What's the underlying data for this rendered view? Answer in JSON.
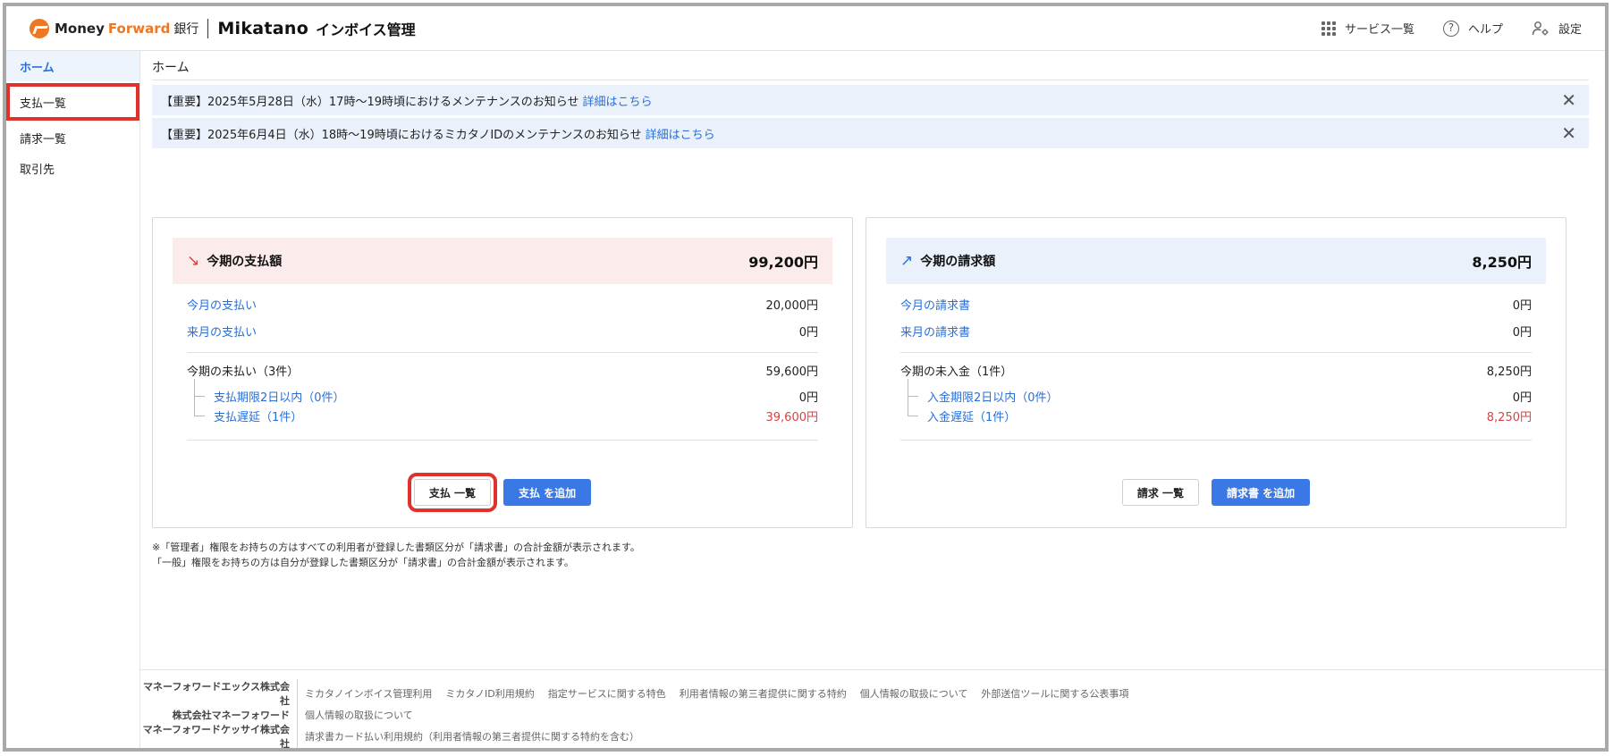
{
  "header": {
    "brand": {
      "money": "Money",
      "forward": "Forward",
      "bank": "銀行",
      "app": "Mikatano",
      "product": "インボイス管理"
    },
    "right": [
      {
        "label": "サービス一覧",
        "icon": "grid-icon"
      },
      {
        "label": "ヘルプ",
        "icon": "help-icon"
      },
      {
        "label": "設定",
        "icon": "user-gear-icon"
      }
    ]
  },
  "sidebar": {
    "items": [
      {
        "label": "ホーム",
        "active": true
      },
      {
        "label": "支払一覧",
        "highlighted": true
      },
      {
        "label": "請求一覧"
      },
      {
        "label": "取引先"
      }
    ]
  },
  "main": {
    "title": "ホーム",
    "notices": [
      {
        "text": "【重要】2025年5月28日（水）17時〜19時頃におけるメンテナンスのお知らせ",
        "link": "詳細はこちら",
        "close": "✕"
      },
      {
        "text": "【重要】2025年6月4日（水）18時〜19時頃におけるミカタノIDのメンテナンスのお知らせ",
        "link": "詳細はこちら",
        "close": "✕"
      }
    ],
    "payment_card": {
      "arrow": "↘",
      "title": "今期の支払額",
      "total": "99,200円",
      "rows": {
        "this_month": {
          "label": "今月の支払い",
          "value": "20,000円"
        },
        "next_month": {
          "label": "来月の支払い",
          "value": "0円"
        },
        "unpaid": {
          "label": "今期の未払い（3件）",
          "value": "59,600円"
        },
        "due_soon": {
          "label": "支払期限2日以内（0件）",
          "value": "0円"
        },
        "overdue": {
          "label": "支払遅延（1件）",
          "value": "39,600円"
        }
      },
      "buttons": {
        "list": "支払 一覧",
        "add": "支払 を追加"
      }
    },
    "billing_card": {
      "arrow": "↗",
      "title": "今期の請求額",
      "total": "8,250円",
      "rows": {
        "this_month": {
          "label": "今月の請求書",
          "value": "0円"
        },
        "next_month": {
          "label": "来月の請求書",
          "value": "0円"
        },
        "unreceived": {
          "label": "今期の未入金（1件）",
          "value": "8,250円"
        },
        "due_soon": {
          "label": "入金期限2日以内（0件）",
          "value": "0円"
        },
        "overdue": {
          "label": "入金遅延（1件）",
          "value": "8,250円"
        }
      },
      "buttons": {
        "list": "請求 一覧",
        "add": "請求書 を追加"
      }
    },
    "note": {
      "line1": "※「管理者」権限をお持ちの方はすべての利用者が登録した書類区分が「請求書」の合計金額が表示されます。",
      "line2": "「一般」権限をお持ちの方は自分が登録した書類区分が「請求書」の合計金額が表示されます。"
    }
  },
  "footer": {
    "rows": [
      {
        "company": "マネーフォワードエックス株式会社",
        "links": [
          "ミカタノインボイス管理利用",
          "ミカタノID利用規約",
          "指定サービスに関する特色",
          "利用者情報の第三者提供に関する特約",
          "個人情報の取扱について",
          "外部送信ツールに関する公表事項"
        ]
      },
      {
        "company": "株式会社マネーフォワード",
        "links": [
          "個人情報の取扱について"
        ]
      },
      {
        "company": "マネーフォワードケッサイ株式会社",
        "links": [
          "請求書カード払い利用規約（利用者情報の第三者提供に関する特約を含む）"
        ]
      }
    ]
  },
  "colors": {
    "accent": "#2a6fd6",
    "primary_button": "#3a78e6",
    "highlight": "#e0312b",
    "negative": "#d84343"
  }
}
